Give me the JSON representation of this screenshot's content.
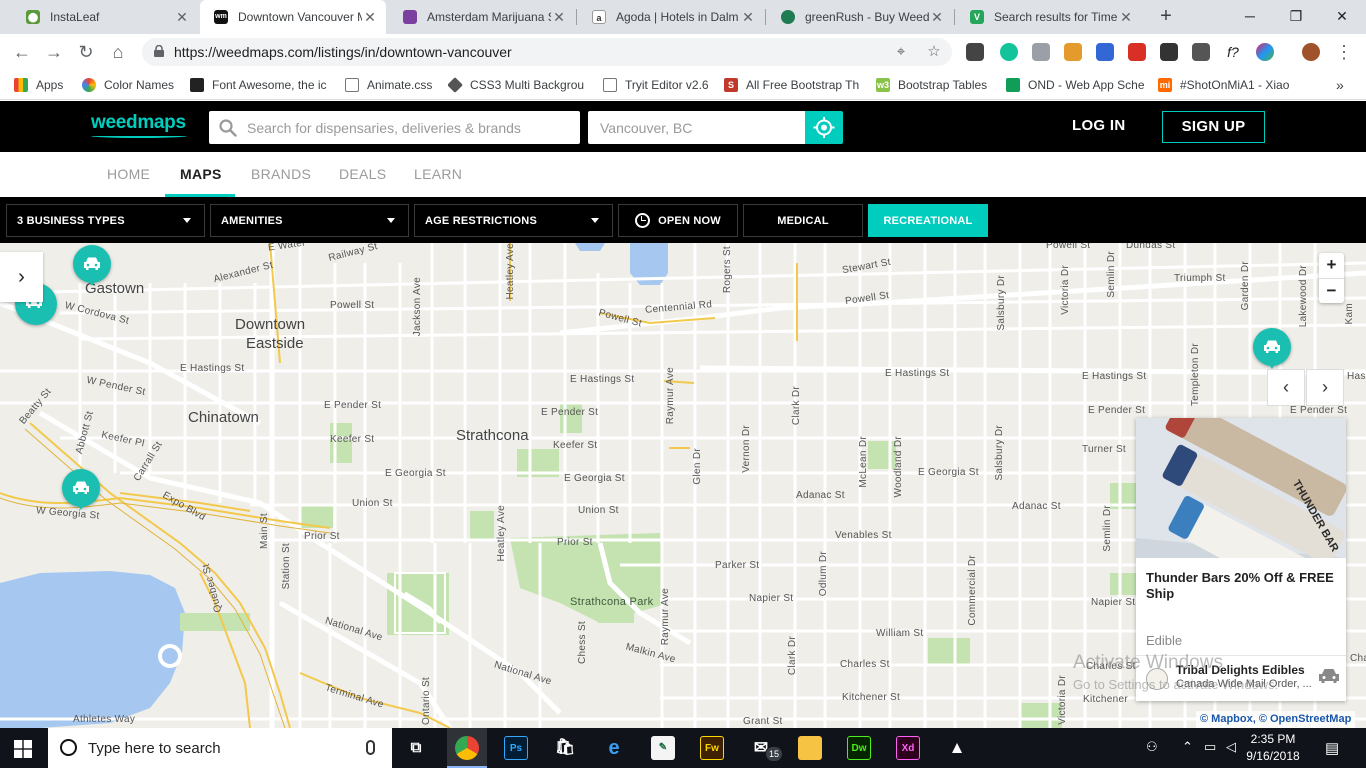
{
  "browser": {
    "tabs": [
      {
        "title": "InstaLeaf",
        "favicon": "instaleaf-icon",
        "color": "#5a9a3b"
      },
      {
        "title": "Downtown Vancouver M",
        "favicon": "weedmaps-icon",
        "color": "#111111"
      },
      {
        "title": "Amsterdam Marijuana S",
        "favicon": "shop-icon",
        "color": "#7b3fa0"
      },
      {
        "title": "Agoda | Hotels in Dalm",
        "favicon": "agoda-icon",
        "color": "#ffffff"
      },
      {
        "title": "greenRush - Buy Weed",
        "favicon": "greenrush-icon",
        "color": "#1e7b52"
      },
      {
        "title": "Search results for Time",
        "favicon": "theme-icon",
        "color": "#26a65b"
      }
    ],
    "url": "https://weedmaps.com/listings/in/downtown-vancouver",
    "bookmarks": [
      {
        "label": "Apps",
        "icon": "apps-grid-icon"
      },
      {
        "label": "Color Names",
        "icon": "color-wheel-icon"
      },
      {
        "label": "Font Awesome, the ic",
        "icon": "font-awesome-icon"
      },
      {
        "label": "Animate.css",
        "icon": "page-icon"
      },
      {
        "label": "CSS3 Multi Backgrou",
        "icon": "diamond-icon"
      },
      {
        "label": "Tryit Editor v2.6",
        "icon": "page-icon"
      },
      {
        "label": "All Free Bootstrap Th",
        "icon": "s-icon"
      },
      {
        "label": "Bootstrap Tables",
        "icon": "w3-icon"
      },
      {
        "label": "OND - Web App Sche",
        "icon": "sheet-icon"
      },
      {
        "label": "#ShotOnMiA1 - Xiao",
        "icon": "mi-icon"
      }
    ]
  },
  "header": {
    "logo": "weedmaps",
    "search_placeholder": "Search for dispensaries, deliveries & brands",
    "location_placeholder": "Vancouver, BC",
    "login": "LOG IN",
    "signup": "SIGN UP"
  },
  "nav": {
    "home": "HOME",
    "maps": "MAPS",
    "brands": "BRANDS",
    "deals": "DEALS",
    "learn": "LEARN"
  },
  "filters": {
    "business_types": "3 BUSINESS TYPES",
    "amenities": "AMENITIES",
    "age": "AGE RESTRICTIONS",
    "open_now": "OPEN NOW",
    "medical": "MEDICAL",
    "recreational": "RECREATIONAL"
  },
  "map": {
    "neighborhoods": {
      "gastown": "Gastown",
      "dtes1": "Downtown",
      "dtes2": "Eastside",
      "chinatown": "Chinatown",
      "strathcona": "Strathcona"
    },
    "parks": {
      "strathcona_park": "Strathcona Park"
    },
    "streets": {
      "alexander": "Alexander St",
      "railway": "Railway St",
      "ewater": "E Water",
      "powell_w": "Powell St",
      "wcordova": "W Cordova St",
      "wpender": "W Pender St",
      "beatty": "Beatty St",
      "abbott": "Abbott St",
      "keefer_pl": "Keefer Pl",
      "carrall": "Carrall St",
      "ehastings_w": "E Hastings St",
      "epender_w": "E Pender St",
      "keefer_w": "Keefer St",
      "egeorgia_w": "E Georgia St",
      "union_w": "Union St",
      "expo": "Expo Blvd",
      "wgeorgia": "W Georgia St",
      "prior_w": "Prior St",
      "main": "Main St",
      "station": "Station St",
      "quebec": "Quebec St",
      "national1": "National Ave",
      "national2": "National Ave",
      "terminal": "Terminal Ave",
      "athletes": "Athletes Way",
      "ontario": "Ontario St",
      "jackson": "Jackson Ave",
      "heatley_n": "Heatley Ave",
      "centennial": "Centennial Rd",
      "powell_m": "Powell St",
      "ehastings_m": "E Hastings St",
      "epender_m": "E Pender St",
      "keefer_m": "Keefer St",
      "egeorgia_m": "E Georgia St",
      "union_m": "Union St",
      "prior_m": "Prior St",
      "heatley_s": "Heatley Ave",
      "chess": "Chess St",
      "malkin": "Malkin Ave",
      "raymur_n": "Raymur Ave",
      "raymur_s": "Raymur Ave",
      "glen": "Glen Dr",
      "vernon": "Vernon Dr",
      "clark_n": "Clark Dr",
      "clark_s": "Clark Dr",
      "rogers": "Rogers St",
      "stewart": "Stewart St",
      "powell_e": "Powell St",
      "ehastings_e": "E Hastings St",
      "adanac_m": "Adanac St",
      "venables": "Venables St",
      "parker": "Parker St",
      "napier_m": "Napier St",
      "william": "William St",
      "charles_m": "Charles St",
      "kitchener_m": "Kitchener St",
      "grant": "Grant St",
      "mclean": "McLean Dr",
      "woodland": "Woodland Dr",
      "odlum": "Odlum Dr",
      "salsbury_n": "Salsbury Dr",
      "salsbury_s": "Salsbury Dr",
      "commercial": "Commercial Dr",
      "victoria_n": "Victoria Dr",
      "victoria_s": "Victoria Dr",
      "egeorgia_e": "E Georgia St",
      "adanac_e": "Adanac St",
      "semlin_n": "Semlin Dr",
      "semlin_s": "Semlin Dr",
      "triumph": "Triumph St",
      "dundas": "Dundas St",
      "powell_ne": "Powell St",
      "ehastings_ne": "E Hastings St",
      "epender_ne": "E Pender St",
      "turner": "Turner St",
      "napier_e": "Napier St",
      "charles_e": "Charles St",
      "kitchener_e": "Kitchener",
      "lakewood": "Lakewood Dr",
      "garden": "Garden Dr",
      "templeton": "Templeton Dr",
      "kam": "Kam",
      "hasti": "Hasti",
      "epender_edge": "E Pender St",
      "cha": "Cha"
    },
    "zoom_in": "+",
    "zoom_out": "−",
    "sidebar_toggle": "›",
    "prev": "‹",
    "next": "›",
    "attribution_mapbox": "© Mapbox,",
    "attribution_osm": "© OpenStreetMap",
    "watermark_title": "Activate Windows",
    "watermark_sub": "Go to Settings to activate Windows."
  },
  "deal_card": {
    "title": "Thunder Bars 20% Off & FREE Ship",
    "category": "Edible",
    "seller": "Tribal Delights Edibles",
    "seller_desc": "Canada Wide Mail Order, ...",
    "image_text": "THUNDER BAR"
  },
  "taskbar": {
    "search_placeholder": "Type here to search",
    "mail_badge": "15",
    "time": "2:35 PM",
    "date": "9/16/2018"
  },
  "colors": {
    "brand": "#00cdbe",
    "map_bg": "#efeee9",
    "park": "#b8dca5",
    "water": "#a6c8f0",
    "highway": "#f2c94c"
  }
}
